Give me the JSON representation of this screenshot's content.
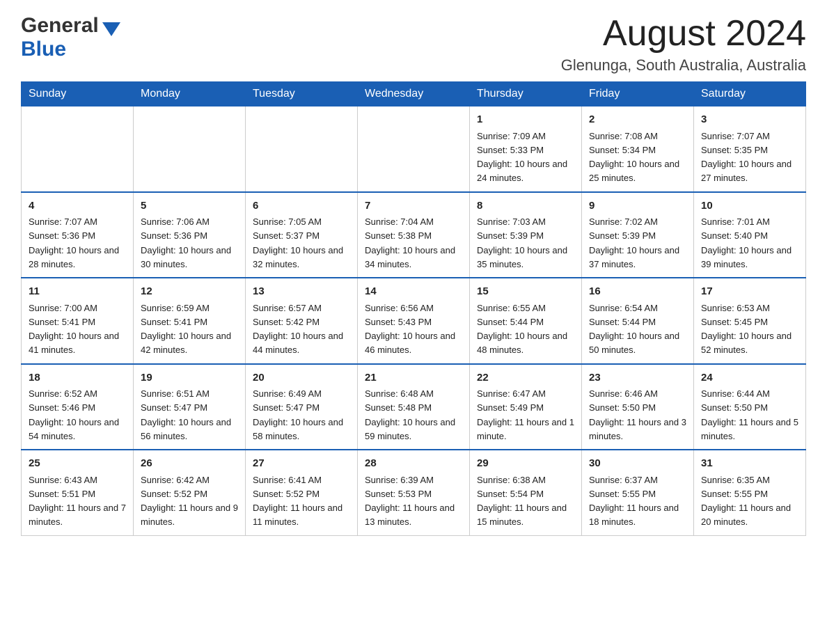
{
  "logo": {
    "general": "General",
    "blue": "Blue"
  },
  "header": {
    "month_year": "August 2024",
    "location": "Glenunga, South Australia, Australia"
  },
  "weekdays": [
    "Sunday",
    "Monday",
    "Tuesday",
    "Wednesday",
    "Thursday",
    "Friday",
    "Saturday"
  ],
  "weeks": [
    [
      {
        "day": "",
        "info": ""
      },
      {
        "day": "",
        "info": ""
      },
      {
        "day": "",
        "info": ""
      },
      {
        "day": "",
        "info": ""
      },
      {
        "day": "1",
        "info": "Sunrise: 7:09 AM\nSunset: 5:33 PM\nDaylight: 10 hours and 24 minutes."
      },
      {
        "day": "2",
        "info": "Sunrise: 7:08 AM\nSunset: 5:34 PM\nDaylight: 10 hours and 25 minutes."
      },
      {
        "day": "3",
        "info": "Sunrise: 7:07 AM\nSunset: 5:35 PM\nDaylight: 10 hours and 27 minutes."
      }
    ],
    [
      {
        "day": "4",
        "info": "Sunrise: 7:07 AM\nSunset: 5:36 PM\nDaylight: 10 hours and 28 minutes."
      },
      {
        "day": "5",
        "info": "Sunrise: 7:06 AM\nSunset: 5:36 PM\nDaylight: 10 hours and 30 minutes."
      },
      {
        "day": "6",
        "info": "Sunrise: 7:05 AM\nSunset: 5:37 PM\nDaylight: 10 hours and 32 minutes."
      },
      {
        "day": "7",
        "info": "Sunrise: 7:04 AM\nSunset: 5:38 PM\nDaylight: 10 hours and 34 minutes."
      },
      {
        "day": "8",
        "info": "Sunrise: 7:03 AM\nSunset: 5:39 PM\nDaylight: 10 hours and 35 minutes."
      },
      {
        "day": "9",
        "info": "Sunrise: 7:02 AM\nSunset: 5:39 PM\nDaylight: 10 hours and 37 minutes."
      },
      {
        "day": "10",
        "info": "Sunrise: 7:01 AM\nSunset: 5:40 PM\nDaylight: 10 hours and 39 minutes."
      }
    ],
    [
      {
        "day": "11",
        "info": "Sunrise: 7:00 AM\nSunset: 5:41 PM\nDaylight: 10 hours and 41 minutes."
      },
      {
        "day": "12",
        "info": "Sunrise: 6:59 AM\nSunset: 5:41 PM\nDaylight: 10 hours and 42 minutes."
      },
      {
        "day": "13",
        "info": "Sunrise: 6:57 AM\nSunset: 5:42 PM\nDaylight: 10 hours and 44 minutes."
      },
      {
        "day": "14",
        "info": "Sunrise: 6:56 AM\nSunset: 5:43 PM\nDaylight: 10 hours and 46 minutes."
      },
      {
        "day": "15",
        "info": "Sunrise: 6:55 AM\nSunset: 5:44 PM\nDaylight: 10 hours and 48 minutes."
      },
      {
        "day": "16",
        "info": "Sunrise: 6:54 AM\nSunset: 5:44 PM\nDaylight: 10 hours and 50 minutes."
      },
      {
        "day": "17",
        "info": "Sunrise: 6:53 AM\nSunset: 5:45 PM\nDaylight: 10 hours and 52 minutes."
      }
    ],
    [
      {
        "day": "18",
        "info": "Sunrise: 6:52 AM\nSunset: 5:46 PM\nDaylight: 10 hours and 54 minutes."
      },
      {
        "day": "19",
        "info": "Sunrise: 6:51 AM\nSunset: 5:47 PM\nDaylight: 10 hours and 56 minutes."
      },
      {
        "day": "20",
        "info": "Sunrise: 6:49 AM\nSunset: 5:47 PM\nDaylight: 10 hours and 58 minutes."
      },
      {
        "day": "21",
        "info": "Sunrise: 6:48 AM\nSunset: 5:48 PM\nDaylight: 10 hours and 59 minutes."
      },
      {
        "day": "22",
        "info": "Sunrise: 6:47 AM\nSunset: 5:49 PM\nDaylight: 11 hours and 1 minute."
      },
      {
        "day": "23",
        "info": "Sunrise: 6:46 AM\nSunset: 5:50 PM\nDaylight: 11 hours and 3 minutes."
      },
      {
        "day": "24",
        "info": "Sunrise: 6:44 AM\nSunset: 5:50 PM\nDaylight: 11 hours and 5 minutes."
      }
    ],
    [
      {
        "day": "25",
        "info": "Sunrise: 6:43 AM\nSunset: 5:51 PM\nDaylight: 11 hours and 7 minutes."
      },
      {
        "day": "26",
        "info": "Sunrise: 6:42 AM\nSunset: 5:52 PM\nDaylight: 11 hours and 9 minutes."
      },
      {
        "day": "27",
        "info": "Sunrise: 6:41 AM\nSunset: 5:52 PM\nDaylight: 11 hours and 11 minutes."
      },
      {
        "day": "28",
        "info": "Sunrise: 6:39 AM\nSunset: 5:53 PM\nDaylight: 11 hours and 13 minutes."
      },
      {
        "day": "29",
        "info": "Sunrise: 6:38 AM\nSunset: 5:54 PM\nDaylight: 11 hours and 15 minutes."
      },
      {
        "day": "30",
        "info": "Sunrise: 6:37 AM\nSunset: 5:55 PM\nDaylight: 11 hours and 18 minutes."
      },
      {
        "day": "31",
        "info": "Sunrise: 6:35 AM\nSunset: 5:55 PM\nDaylight: 11 hours and 20 minutes."
      }
    ]
  ]
}
